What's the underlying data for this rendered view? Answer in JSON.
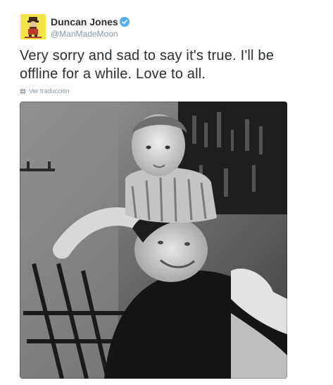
{
  "user": {
    "display_name": "Duncan Jones",
    "handle": "@ManMadeMoon",
    "verified": true,
    "avatar_icon": "avatar-cartoon-character",
    "avatar_bg_color": "#f5e34a",
    "verified_color": "#55acee"
  },
  "tweet": {
    "text": "Very sorry and sad to say it's true.  I'll be offline for a while.  Love to all.",
    "translate_label": "Ver traducción",
    "translate_icon": "globe-icon"
  },
  "media": {
    "type": "photo",
    "style": "black-and-white",
    "subject": "photo"
  },
  "colors": {
    "text": "#292f33",
    "secondary_text": "#8899a6"
  }
}
